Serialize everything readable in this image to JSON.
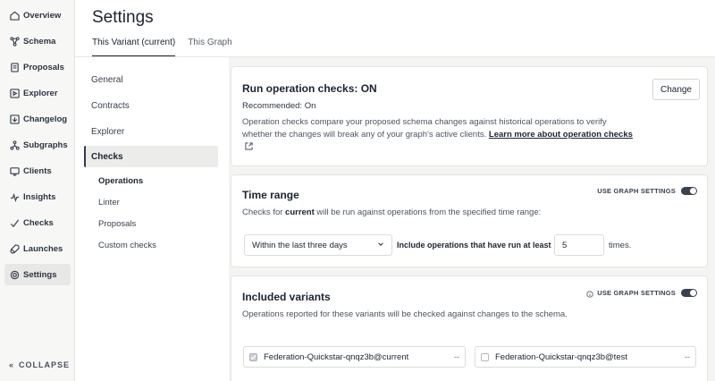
{
  "sidebar": {
    "items": [
      {
        "label": "Overview",
        "icon": "overview-icon"
      },
      {
        "label": "Schema",
        "icon": "schema-icon"
      },
      {
        "label": "Proposals",
        "icon": "proposals-icon"
      },
      {
        "label": "Explorer",
        "icon": "explorer-icon"
      },
      {
        "label": "Changelog",
        "icon": "changelog-icon"
      },
      {
        "label": "Subgraphs",
        "icon": "subgraphs-icon"
      },
      {
        "label": "Clients",
        "icon": "clients-icon"
      },
      {
        "label": "Insights",
        "icon": "insights-icon"
      },
      {
        "label": "Checks",
        "icon": "checks-icon"
      },
      {
        "label": "Launches",
        "icon": "launches-icon"
      },
      {
        "label": "Settings",
        "icon": "settings-icon"
      }
    ],
    "active": "Settings",
    "collapse_label": "COLLAPSE"
  },
  "header": {
    "title": "Settings",
    "tabs": [
      {
        "label": "This Variant (current)",
        "active": true
      },
      {
        "label": "This Graph",
        "active": false
      }
    ]
  },
  "subnav": {
    "items": [
      "General",
      "Contracts",
      "Explorer",
      "Checks"
    ],
    "active": "Checks",
    "sub_items": [
      "Operations",
      "Linter",
      "Proposals",
      "Custom checks"
    ],
    "active_sub": "Operations"
  },
  "operation_checks": {
    "title": "Run operation checks: ON",
    "recommended": "Recommended: On",
    "description": "Operation checks compare your proposed schema changes against historical operations to verify whether the changes will break any of your graph's active clients.",
    "link_text": "Learn more about operation checks",
    "change_button": "Change"
  },
  "time_range": {
    "title": "Time range",
    "toggle_label": "USE GRAPH SETTINGS",
    "toggle_on": false,
    "desc_prefix": "Checks for ",
    "desc_variant": "current",
    "desc_suffix": " will be run against operations from the specified time range:",
    "select_value": "Within the last three days",
    "include_label": "Include operations that have run at least",
    "count_value": "5",
    "times_label": "times."
  },
  "included_variants": {
    "title": "Included variants",
    "toggle_label": "USE GRAPH SETTINGS",
    "toggle_on": true,
    "description": "Operations reported for these variants will be checked against changes to the schema.",
    "variants": [
      {
        "name": "Federation-Quickstar-qnqz3b@current",
        "checked": true,
        "suffix": "--"
      },
      {
        "name": "Federation-Quickstar-qnqz3b@test",
        "checked": false,
        "suffix": "--"
      }
    ]
  },
  "colors": {
    "sidebar_bg": "#f7f7f6",
    "main_bg": "#f4f4f2",
    "text": "#1c2430",
    "toggle_on": "#3a424d"
  }
}
